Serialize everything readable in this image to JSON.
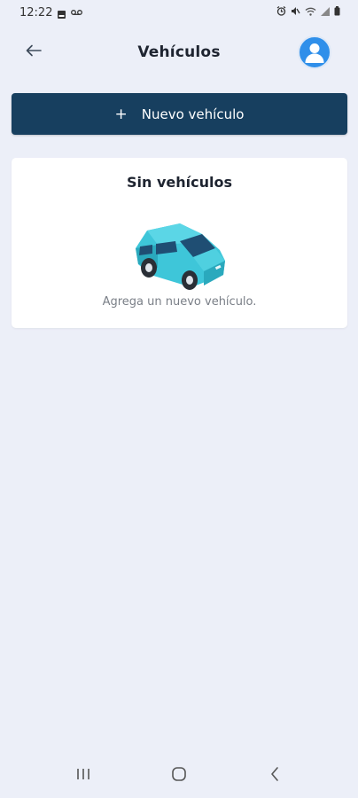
{
  "status_bar": {
    "time": "12:22",
    "icons": [
      "image-icon",
      "voicemail-icon",
      "alarm-icon",
      "mute-icon",
      "wifi-icon",
      "signal-icon",
      "battery-icon"
    ]
  },
  "header": {
    "title": "Vehículos",
    "back_icon": "arrow-left-icon",
    "avatar_icon": "user-icon"
  },
  "actions": {
    "new_vehicle_plus": "+",
    "new_vehicle_label": "Nuevo vehículo"
  },
  "empty_state": {
    "title": "Sin vehículos",
    "message": "Agrega un nuevo vehículo.",
    "illustration": "car-illustration"
  },
  "nav_bar": {
    "items": [
      "recent-apps-icon",
      "home-icon",
      "back-icon"
    ]
  },
  "colors": {
    "background": "#eceff8",
    "primary": "#173f5f",
    "avatar": "#2f8fea",
    "car": "#3ec6d9"
  }
}
